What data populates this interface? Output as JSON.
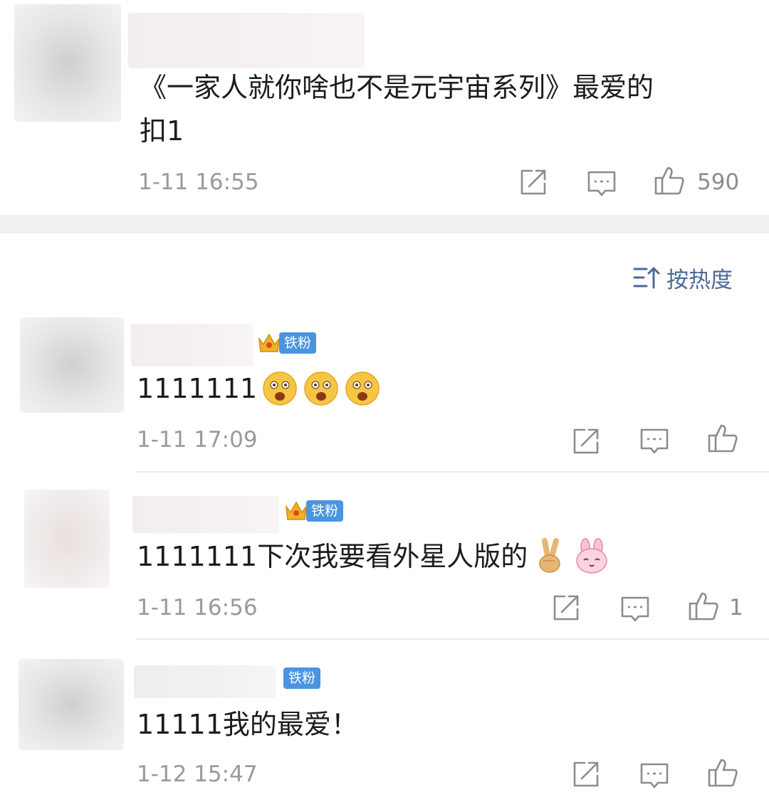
{
  "top_comment": {
    "text_line1": "《一家人就你啥也不是元宇宙系列》最爱的",
    "text_line2": "扣1",
    "time": "1-11 16:55",
    "like_count": "590",
    "share_icon": "share-icon",
    "comment_icon": "comment-icon",
    "like_icon": "thumbs-up-icon"
  },
  "sort": {
    "icon": "sort-icon",
    "label": "按热度"
  },
  "replies": [
    {
      "badge": "铁粉",
      "text": "1111111",
      "emojis": [
        "drooling-face-emoji",
        "drooling-face-emoji",
        "drooling-face-emoji"
      ],
      "time": "1-11 17:09",
      "like_count": ""
    },
    {
      "badge": "铁粉",
      "text": "1111111下次我要看外星人版的",
      "emojis": [
        "victory-hand-emoji",
        "pink-bunny-emoji"
      ],
      "time": "1-11 16:56",
      "like_count": "1"
    },
    {
      "badge": "铁粉",
      "text": "11111我的最爱！",
      "emojis": [],
      "time": "1-12 15:47",
      "like_count": ""
    }
  ],
  "colors": {
    "badge_blue": "#4a94e0",
    "sort_blue": "#4a6a99",
    "time_gray": "#9a9a9a",
    "separator": "#f0f0f2"
  }
}
